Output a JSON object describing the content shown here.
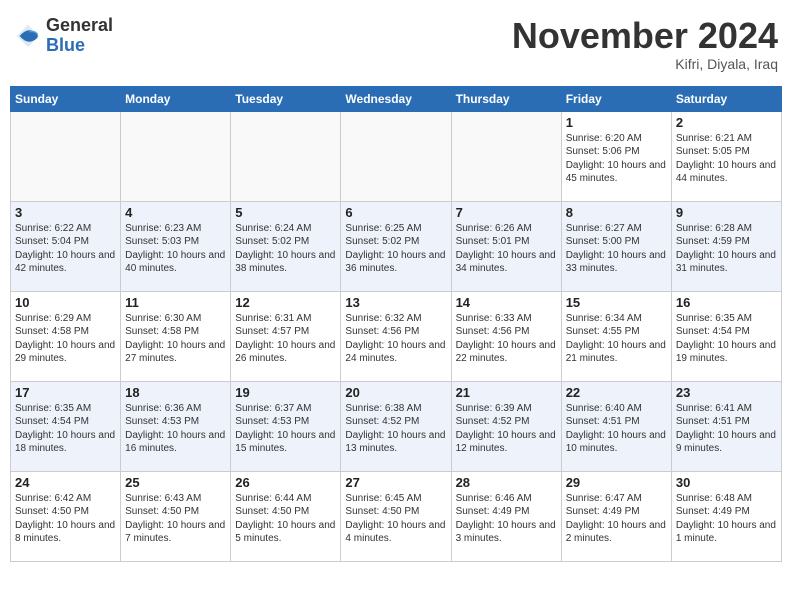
{
  "header": {
    "logo_general": "General",
    "logo_blue": "Blue",
    "month_title": "November 2024",
    "location": "Kifri, Diyala, Iraq"
  },
  "weekdays": [
    "Sunday",
    "Monday",
    "Tuesday",
    "Wednesday",
    "Thursday",
    "Friday",
    "Saturday"
  ],
  "rows": [
    {
      "class": "row1",
      "cells": [
        {
          "empty": true
        },
        {
          "empty": true
        },
        {
          "empty": true
        },
        {
          "empty": true
        },
        {
          "empty": true
        },
        {
          "day": "1",
          "info": "Sunrise: 6:20 AM\nSunset: 5:06 PM\nDaylight: 10 hours\nand 45 minutes."
        },
        {
          "day": "2",
          "info": "Sunrise: 6:21 AM\nSunset: 5:05 PM\nDaylight: 10 hours\nand 44 minutes."
        }
      ]
    },
    {
      "class": "row2",
      "cells": [
        {
          "day": "3",
          "info": "Sunrise: 6:22 AM\nSunset: 5:04 PM\nDaylight: 10 hours\nand 42 minutes."
        },
        {
          "day": "4",
          "info": "Sunrise: 6:23 AM\nSunset: 5:03 PM\nDaylight: 10 hours\nand 40 minutes."
        },
        {
          "day": "5",
          "info": "Sunrise: 6:24 AM\nSunset: 5:02 PM\nDaylight: 10 hours\nand 38 minutes."
        },
        {
          "day": "6",
          "info": "Sunrise: 6:25 AM\nSunset: 5:02 PM\nDaylight: 10 hours\nand 36 minutes."
        },
        {
          "day": "7",
          "info": "Sunrise: 6:26 AM\nSunset: 5:01 PM\nDaylight: 10 hours\nand 34 minutes."
        },
        {
          "day": "8",
          "info": "Sunrise: 6:27 AM\nSunset: 5:00 PM\nDaylight: 10 hours\nand 33 minutes."
        },
        {
          "day": "9",
          "info": "Sunrise: 6:28 AM\nSunset: 4:59 PM\nDaylight: 10 hours\nand 31 minutes."
        }
      ]
    },
    {
      "class": "row3",
      "cells": [
        {
          "day": "10",
          "info": "Sunrise: 6:29 AM\nSunset: 4:58 PM\nDaylight: 10 hours\nand 29 minutes."
        },
        {
          "day": "11",
          "info": "Sunrise: 6:30 AM\nSunset: 4:58 PM\nDaylight: 10 hours\nand 27 minutes."
        },
        {
          "day": "12",
          "info": "Sunrise: 6:31 AM\nSunset: 4:57 PM\nDaylight: 10 hours\nand 26 minutes."
        },
        {
          "day": "13",
          "info": "Sunrise: 6:32 AM\nSunset: 4:56 PM\nDaylight: 10 hours\nand 24 minutes."
        },
        {
          "day": "14",
          "info": "Sunrise: 6:33 AM\nSunset: 4:56 PM\nDaylight: 10 hours\nand 22 minutes."
        },
        {
          "day": "15",
          "info": "Sunrise: 6:34 AM\nSunset: 4:55 PM\nDaylight: 10 hours\nand 21 minutes."
        },
        {
          "day": "16",
          "info": "Sunrise: 6:35 AM\nSunset: 4:54 PM\nDaylight: 10 hours\nand 19 minutes."
        }
      ]
    },
    {
      "class": "row4",
      "cells": [
        {
          "day": "17",
          "info": "Sunrise: 6:35 AM\nSunset: 4:54 PM\nDaylight: 10 hours\nand 18 minutes."
        },
        {
          "day": "18",
          "info": "Sunrise: 6:36 AM\nSunset: 4:53 PM\nDaylight: 10 hours\nand 16 minutes."
        },
        {
          "day": "19",
          "info": "Sunrise: 6:37 AM\nSunset: 4:53 PM\nDaylight: 10 hours\nand 15 minutes."
        },
        {
          "day": "20",
          "info": "Sunrise: 6:38 AM\nSunset: 4:52 PM\nDaylight: 10 hours\nand 13 minutes."
        },
        {
          "day": "21",
          "info": "Sunrise: 6:39 AM\nSunset: 4:52 PM\nDaylight: 10 hours\nand 12 minutes."
        },
        {
          "day": "22",
          "info": "Sunrise: 6:40 AM\nSunset: 4:51 PM\nDaylight: 10 hours\nand 10 minutes."
        },
        {
          "day": "23",
          "info": "Sunrise: 6:41 AM\nSunset: 4:51 PM\nDaylight: 10 hours\nand 9 minutes."
        }
      ]
    },
    {
      "class": "row5",
      "cells": [
        {
          "day": "24",
          "info": "Sunrise: 6:42 AM\nSunset: 4:50 PM\nDaylight: 10 hours\nand 8 minutes."
        },
        {
          "day": "25",
          "info": "Sunrise: 6:43 AM\nSunset: 4:50 PM\nDaylight: 10 hours\nand 7 minutes."
        },
        {
          "day": "26",
          "info": "Sunrise: 6:44 AM\nSunset: 4:50 PM\nDaylight: 10 hours\nand 5 minutes."
        },
        {
          "day": "27",
          "info": "Sunrise: 6:45 AM\nSunset: 4:50 PM\nDaylight: 10 hours\nand 4 minutes."
        },
        {
          "day": "28",
          "info": "Sunrise: 6:46 AM\nSunset: 4:49 PM\nDaylight: 10 hours\nand 3 minutes."
        },
        {
          "day": "29",
          "info": "Sunrise: 6:47 AM\nSunset: 4:49 PM\nDaylight: 10 hours\nand 2 minutes."
        },
        {
          "day": "30",
          "info": "Sunrise: 6:48 AM\nSunset: 4:49 PM\nDaylight: 10 hours\nand 1 minute."
        }
      ]
    }
  ]
}
